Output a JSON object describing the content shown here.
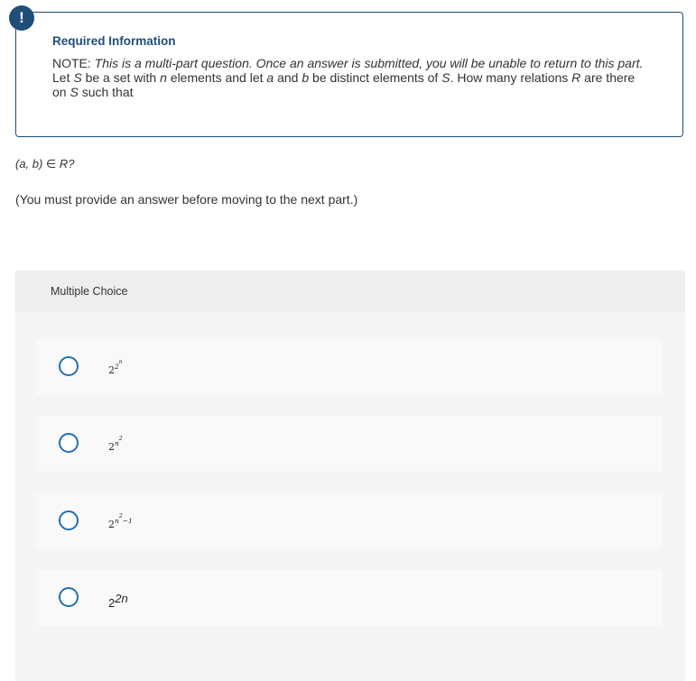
{
  "info": {
    "title": "Required Information",
    "note_label": "NOTE:",
    "note_text": "This is a multi-part question. Once an answer is submitted, you will be unable to return to this part.",
    "line1_a": "Let ",
    "var_S1": "S",
    "line1_b": " be a set with ",
    "var_n": "n",
    "line1_c": " elements and let ",
    "var_a": "a",
    "line1_d": " and ",
    "var_b": "b",
    "line1_e": " be distinct elements of ",
    "var_S2": "S",
    "line1_f": ". How many relations ",
    "var_R": "R",
    "line1_g": " are there on ",
    "var_S3": "S",
    "line1_h": " such that"
  },
  "question": "(a, b) ∈ R?",
  "note": "(You must provide an answer before moving to the next part.)",
  "mc": {
    "header": "Multiple Choice",
    "options": [
      {
        "base": "2",
        "exp": "2",
        "exp2": "n"
      },
      {
        "base": "2",
        "exp": "n",
        "exp2": "2"
      },
      {
        "base": "2",
        "exp": "n",
        "exp2": "2",
        "exp_tail": "−1"
      },
      {
        "base": "2",
        "exp": "2n"
      }
    ]
  },
  "colors": {
    "accent": "#1f4e79",
    "radio": "#1f6fb5",
    "panel": "#f5f5f5"
  },
  "icons": {
    "badge": "exclamation-icon"
  }
}
